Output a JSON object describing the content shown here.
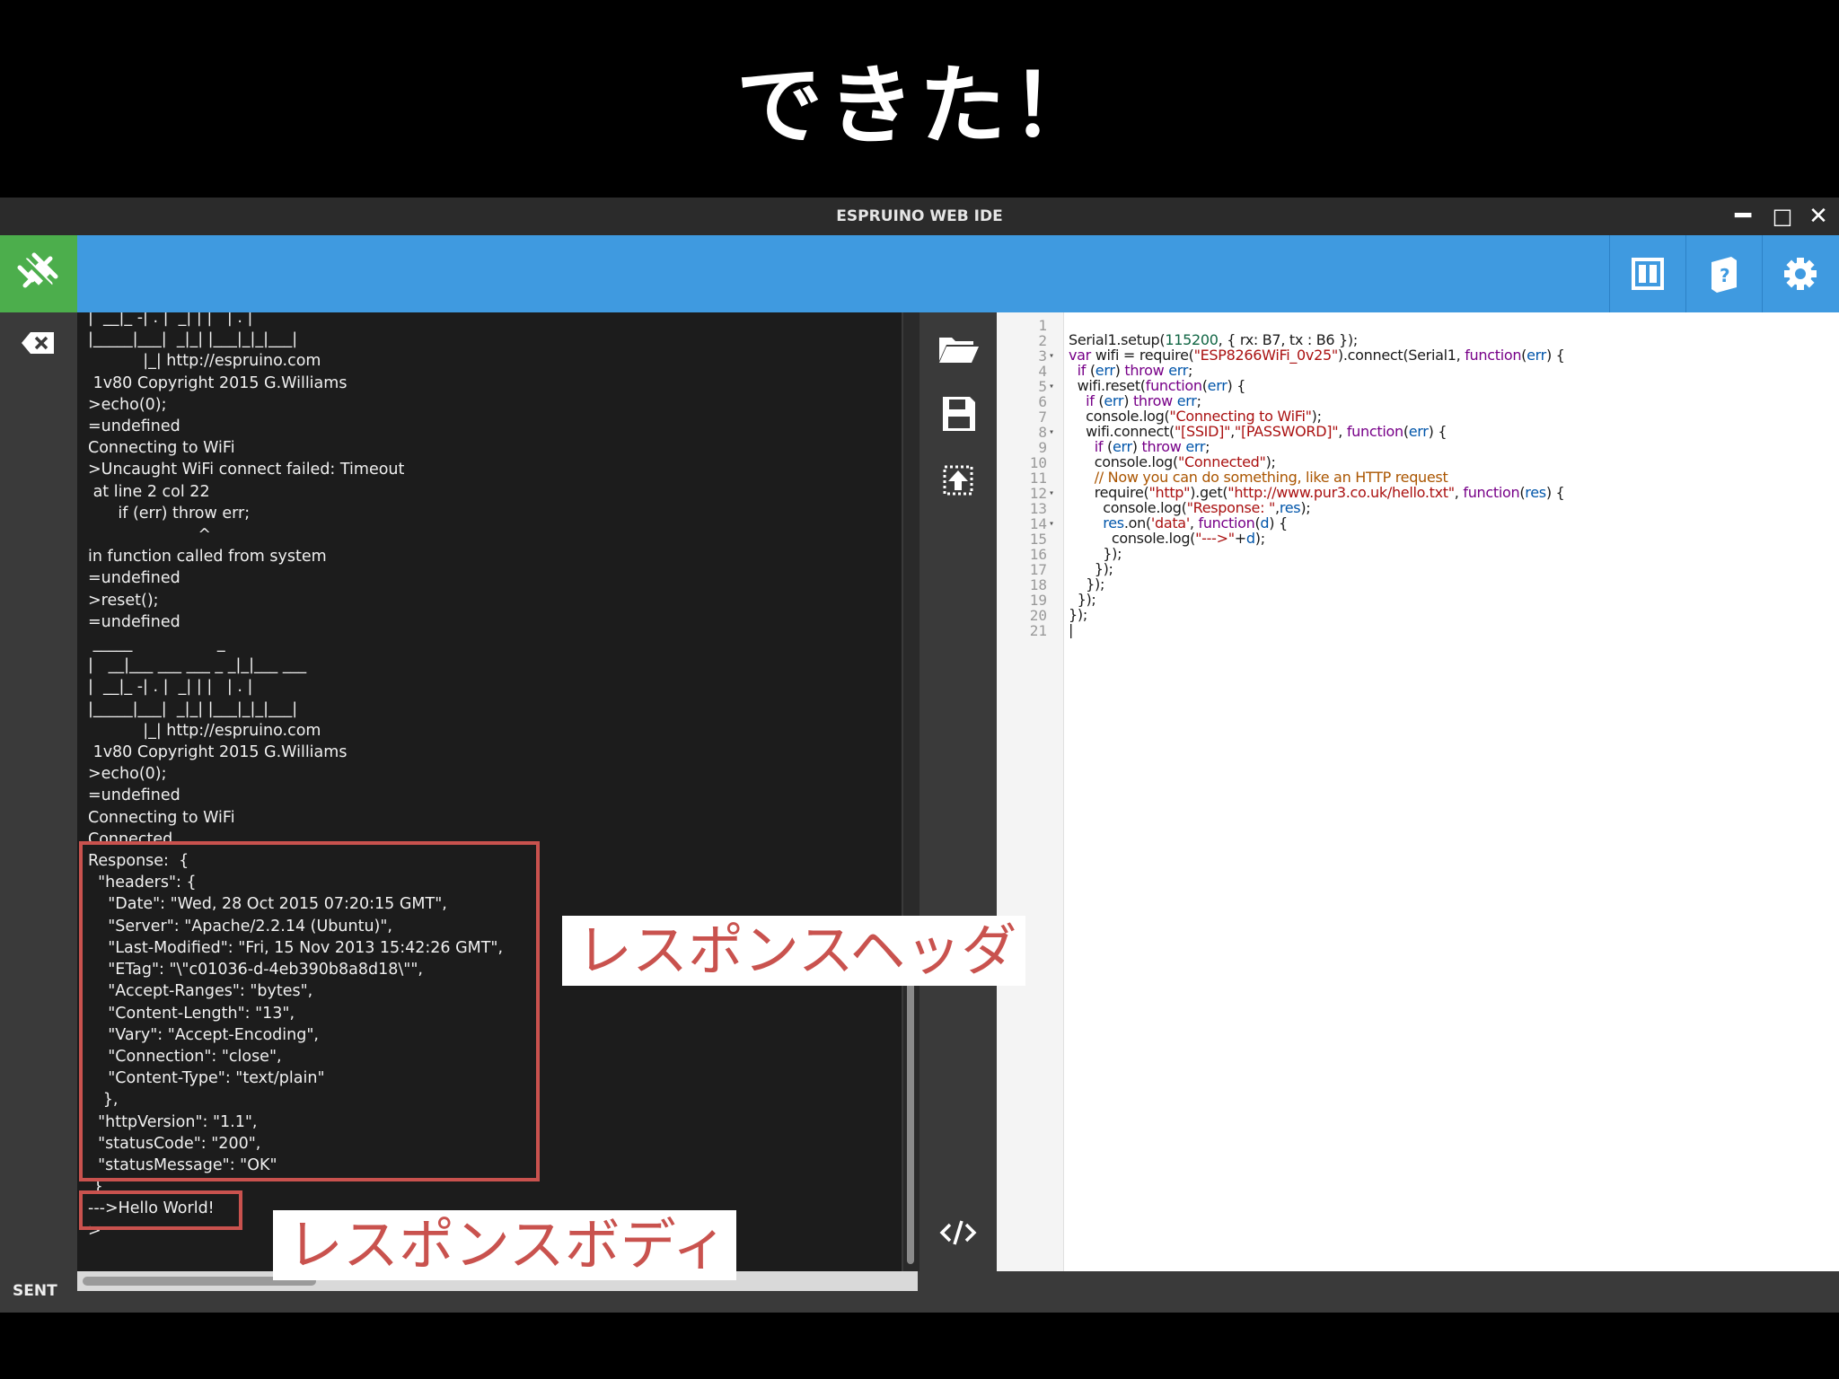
{
  "slide": {
    "title": "できた！"
  },
  "window": {
    "title": "ESPRUINO WEB IDE",
    "minimize": "━",
    "maximize": "□",
    "close": "✕"
  },
  "toolbar": {
    "icons": [
      "connect-icon",
      "split-view-icon",
      "book-help-icon",
      "gear-icon"
    ],
    "accent_color": "#3f9ae0",
    "connect_color": "#4cae4c"
  },
  "status": {
    "label": "SENT"
  },
  "terminal": {
    "lines": [
      "|  __|_ -| . |  _| | |   | . |",
      "|_____|___|  _|_| |___|_|_|___|",
      "           |_| http://espruino.com",
      " 1v80 Copyright 2015 G.Williams",
      ">echo(0);",
      "=undefined",
      "Connecting to WiFi",
      ">Uncaught WiFi connect failed: Timeout",
      " at line 2 col 22",
      "      if (err) throw err;",
      "                      ^",
      "in function called from system",
      "=undefined",
      ">reset();",
      "=undefined",
      " _____                 _",
      "|   __|___ ___ ___ _ _|_|___ ___",
      "|  __|_ -| . |  _| | |   | . |",
      "|_____|___|  _|_| |___|_|_|___|",
      "           |_| http://espruino.com",
      " 1v80 Copyright 2015 G.Williams",
      ">echo(0);",
      "=undefined",
      "Connecting to WiFi",
      "Connected",
      "Response:  {",
      "  \"headers\": {",
      "    \"Date\": \"Wed, 28 Oct 2015 07:20:15 GMT\",",
      "    \"Server\": \"Apache/2.2.14 (Ubuntu)\",",
      "    \"Last-Modified\": \"Fri, 15 Nov 2013 15:42:26 GMT\",",
      "    \"ETag\": \"\\\"c01036-d-4eb390b8a8d18\\\"\",",
      "    \"Accept-Ranges\": \"bytes\",",
      "    \"Content-Length\": \"13\",",
      "    \"Vary\": \"Accept-Encoding\",",
      "    \"Connection\": \"close\",",
      "    \"Content-Type\": \"text/plain\"",
      "   },",
      "  \"httpVersion\": \"1.1\",",
      "  \"statusCode\": \"200\",",
      "  \"statusMessage\": \"OK\"",
      " }",
      "--->Hello World!",
      ">"
    ]
  },
  "editor": {
    "line_numbers": "1\n2\n3\n4\n5\n6\n7\n8\n9\n10\n11\n12\n13\n14\n15\n16\n17\n18\n19\n20\n21",
    "fold_markers": "\n\n▾\n\n▾\n\n\n▾\n\n\n\n▾\n\n▾\n\n\n\n\n\n\n",
    "code": [
      [
        [
          "Serial1.setup(",
          ""
        ],
        [
          "115200",
          "num"
        ],
        [
          ", { rx: B7, tx : B6 });",
          ""
        ]
      ],
      [
        [
          "var",
          "kw"
        ],
        [
          " wifi = require(",
          ""
        ],
        [
          "\"ESP8266WiFi_0v25\"",
          "str"
        ],
        [
          ").connect(Serial1, ",
          ""
        ],
        [
          "function",
          "kw"
        ],
        [
          "(",
          ""
        ],
        [
          "err",
          "var"
        ],
        [
          ") {",
          ""
        ]
      ],
      [
        [
          "  ",
          ""
        ],
        [
          "if",
          "kw"
        ],
        [
          " (",
          ""
        ],
        [
          "err",
          "var"
        ],
        [
          ") ",
          ""
        ],
        [
          "throw",
          "kw"
        ],
        [
          " ",
          ""
        ],
        [
          "err",
          "var"
        ],
        [
          ";",
          ""
        ]
      ],
      [
        [
          "  wifi.reset(",
          ""
        ],
        [
          "function",
          "kw"
        ],
        [
          "(",
          ""
        ],
        [
          "err",
          "var"
        ],
        [
          ") {",
          ""
        ]
      ],
      [
        [
          "    ",
          ""
        ],
        [
          "if",
          "kw"
        ],
        [
          " (",
          ""
        ],
        [
          "err",
          "var"
        ],
        [
          ") ",
          ""
        ],
        [
          "throw",
          "kw"
        ],
        [
          " ",
          ""
        ],
        [
          "err",
          "var"
        ],
        [
          ";",
          ""
        ]
      ],
      [
        [
          "    console.log(",
          ""
        ],
        [
          "\"Connecting to WiFi\"",
          "str"
        ],
        [
          ");",
          ""
        ]
      ],
      [
        [
          "    wifi.connect(",
          ""
        ],
        [
          "\"[SSID]\"",
          "str"
        ],
        [
          ",",
          ""
        ],
        [
          "\"[PASSWORD]\"",
          "str"
        ],
        [
          ", ",
          ""
        ],
        [
          "function",
          "kw"
        ],
        [
          "(",
          ""
        ],
        [
          "err",
          "var"
        ],
        [
          ") {",
          ""
        ]
      ],
      [
        [
          "      ",
          ""
        ],
        [
          "if",
          "kw"
        ],
        [
          " (",
          ""
        ],
        [
          "err",
          "var"
        ],
        [
          ") ",
          ""
        ],
        [
          "throw",
          "kw"
        ],
        [
          " ",
          ""
        ],
        [
          "err",
          "var"
        ],
        [
          ";",
          ""
        ]
      ],
      [
        [
          "      console.log(",
          ""
        ],
        [
          "\"Connected\"",
          "str"
        ],
        [
          ");",
          ""
        ]
      ],
      [
        [
          "      ",
          ""
        ],
        [
          "// Now you can do something, like an HTTP request",
          "cmt"
        ]
      ],
      [
        [
          "      require(",
          ""
        ],
        [
          "\"http\"",
          "str"
        ],
        [
          ").get(",
          ""
        ],
        [
          "\"http://www.pur3.co.uk/hello.txt\"",
          "str"
        ],
        [
          ", ",
          ""
        ],
        [
          "function",
          "kw"
        ],
        [
          "(",
          ""
        ],
        [
          "res",
          "var"
        ],
        [
          ") {",
          ""
        ]
      ],
      [
        [
          "        console.log(",
          ""
        ],
        [
          "\"Response: \"",
          "str"
        ],
        [
          ",",
          ""
        ],
        [
          "res",
          "var"
        ],
        [
          ");",
          ""
        ]
      ],
      [
        [
          "        ",
          ""
        ],
        [
          "res",
          "var"
        ],
        [
          ".on(",
          ""
        ],
        [
          "'data'",
          "str"
        ],
        [
          ", ",
          ""
        ],
        [
          "function",
          "kw"
        ],
        [
          "(",
          ""
        ],
        [
          "d",
          "var"
        ],
        [
          ") {",
          ""
        ]
      ],
      [
        [
          "          console.log(",
          ""
        ],
        [
          "\"--->\"",
          "str"
        ],
        [
          "+",
          ""
        ],
        [
          "d",
          "var"
        ],
        [
          ");",
          ""
        ]
      ],
      [
        [
          "        });",
          ""
        ]
      ],
      [
        [
          "      });",
          ""
        ]
      ],
      [
        [
          "    });",
          ""
        ]
      ],
      [
        [
          "  });",
          ""
        ]
      ],
      [
        [
          "});",
          ""
        ]
      ],
      [
        [
          "|",
          ""
        ]
      ]
    ]
  },
  "callouts": {
    "header": "レスポンスヘッダ",
    "body": "レスポンスボディ"
  },
  "highlight_color": "#c9524e"
}
